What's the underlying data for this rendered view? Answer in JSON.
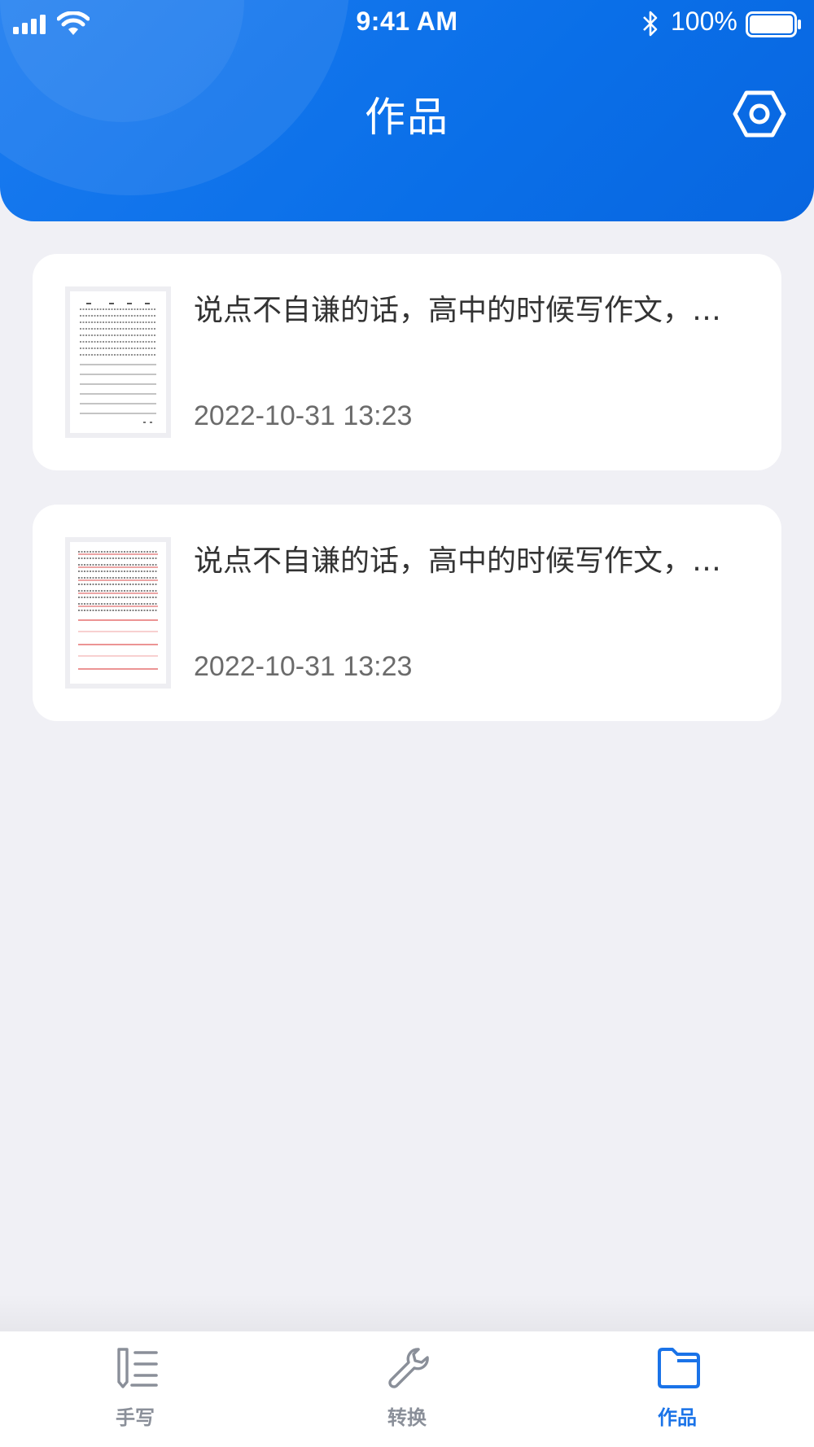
{
  "status_bar": {
    "time": "9:41 AM",
    "battery_percent": "100%",
    "icons": [
      "signal-icon",
      "wifi-icon",
      "bluetooth-icon",
      "battery-icon"
    ]
  },
  "header": {
    "title": "作品",
    "settings_icon": "settings-hexagon-icon"
  },
  "works": [
    {
      "title": "说点不自谦的话，高中的时候写作文，…",
      "date": "2022-10-31 13:23",
      "thumbnail_style": "black-lines"
    },
    {
      "title": "说点不自谦的话，高中的时候写作文，…",
      "date": "2022-10-31 13:23",
      "thumbnail_style": "red-lines"
    }
  ],
  "tabs": [
    {
      "label": "手写",
      "icon": "handwriting-icon",
      "active": false
    },
    {
      "label": "转换",
      "icon": "wrench-icon",
      "active": false
    },
    {
      "label": "作品",
      "icon": "folder-icon",
      "active": true
    }
  ],
  "colors": {
    "accent": "#1a73e8",
    "header_blue": "#0a6fe8",
    "background": "#f0f0f5",
    "inactive_tab": "#8a8f99"
  }
}
